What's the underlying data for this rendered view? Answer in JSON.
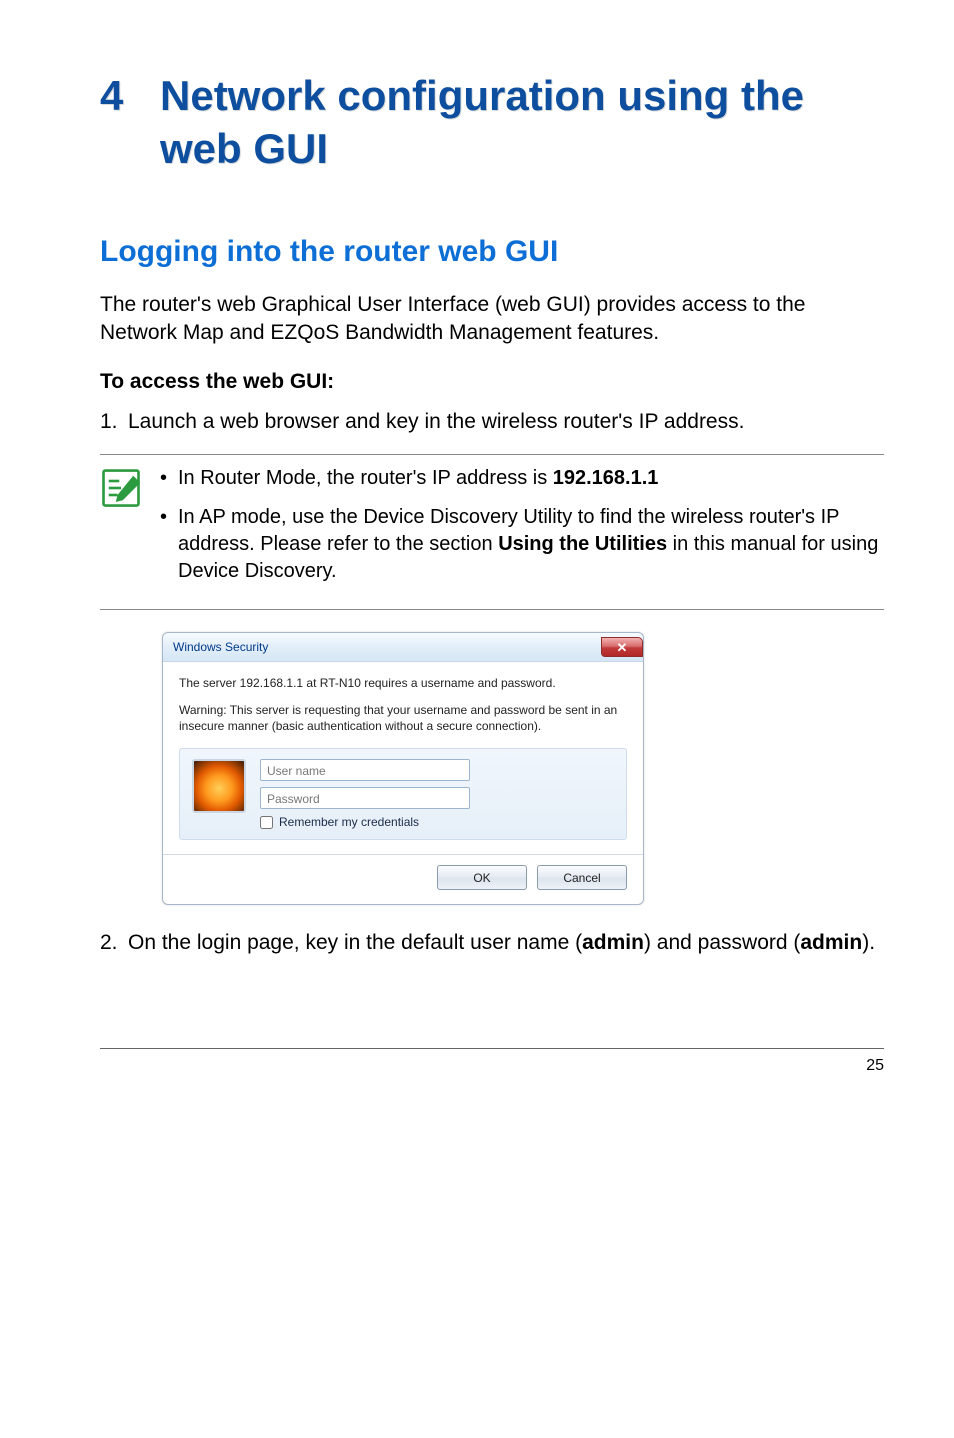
{
  "chapter": {
    "number": "4",
    "title": "Network configuration using the web GUI"
  },
  "section": {
    "title": "Logging into the router web GUI"
  },
  "intro": "The router's web Graphical User Interface (web GUI) provides access to the Network Map and EZQoS Bandwidth Management features.",
  "subhead": "To access the web GUI:",
  "steps": {
    "s1_num": "1.",
    "s1_text": "Launch a web browser and key in the wireless router's IP address.",
    "s2_num": "2.",
    "s2_pre": "On the login page, key in the default user name (",
    "s2_user": "admin",
    "s2_mid": ") and password (",
    "s2_pass": "admin",
    "s2_post": ")."
  },
  "note": {
    "n1_pre": "In Router Mode, the router's IP address is ",
    "n1_ip": "192.168.1.1",
    "n2_pre": "In AP mode, use the Device Discovery Utility to find the wireless router's IP address. Please refer to the section ",
    "n2_bold": "Using the Utilities",
    "n2_post": " in this manual for using Device Discovery."
  },
  "dialog": {
    "title": "Windows Security",
    "close_glyph": "✕",
    "line1": "The server 192.168.1.1 at RT-N10 requires a username and password.",
    "warning": "Warning: This server is requesting that your username and password be sent in an insecure manner (basic authentication without a secure connection).",
    "user_placeholder": "User name",
    "pass_placeholder": "Password",
    "remember_label": "Remember my credentials",
    "ok_label": "OK",
    "cancel_label": "Cancel"
  },
  "page_number": "25"
}
